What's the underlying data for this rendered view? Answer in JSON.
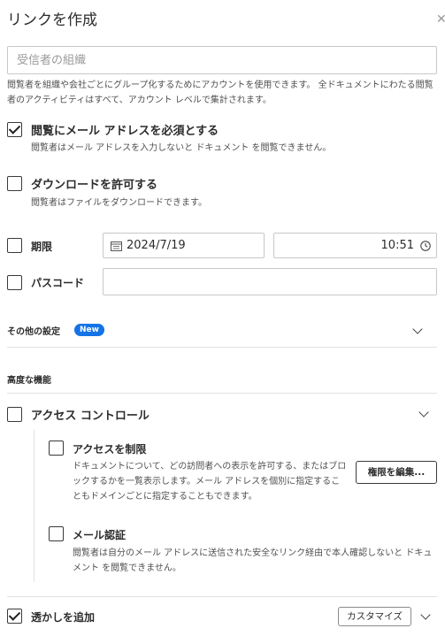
{
  "dialog": {
    "title": "リンクを作成"
  },
  "org": {
    "placeholder": "受信者の組織",
    "help": "閲覧者を組織や会社ごとにグループ化するためにアカウントを使用できます。 全ドキュメントにわたる閲覧者のアクティビティはすべて、アカウント レベルで集計されます。"
  },
  "require_email": {
    "label": "閲覧にメール アドレスを必須とする",
    "help": "閲覧者はメール アドレスを入力しないと ドキュメント を閲覧できません。",
    "checked": true
  },
  "allow_download": {
    "label": "ダウンロードを許可する",
    "help": "閲覧者はファイルをダウンロードできます。",
    "checked": false
  },
  "expiry": {
    "label": "期限",
    "date": "2024/7/19",
    "time": "10:51",
    "checked": false
  },
  "passcode": {
    "label": "パスコード",
    "value": "",
    "checked": false
  },
  "other_settings": {
    "label": "その他の設定",
    "badge": "New"
  },
  "advanced": {
    "heading": "高度な機能",
    "access_control": {
      "label": "アクセス コントロール",
      "checked": false,
      "restrict": {
        "label": "アクセスを制限",
        "help": "ドキュメントについて、どの訪問者への表示を許可する、またはブロックするかを一覧表示します。メール アドレスを個別に指定することもドメインごとに指定することもできます。",
        "button": "権限を編集..."
      },
      "email_auth": {
        "label": "メール認証",
        "help": "閲覧者は自分のメール アドレスに送信された安全なリンク経由で本人確認しないと ドキュメント を閲覧できません。"
      }
    },
    "watermark": {
      "label": "透かしを追加",
      "button": "カスタマイズ",
      "checked": true
    }
  },
  "colors": {
    "accent": "#1473e6",
    "text": "#2c2c2c",
    "border": "#c8c8c8"
  }
}
